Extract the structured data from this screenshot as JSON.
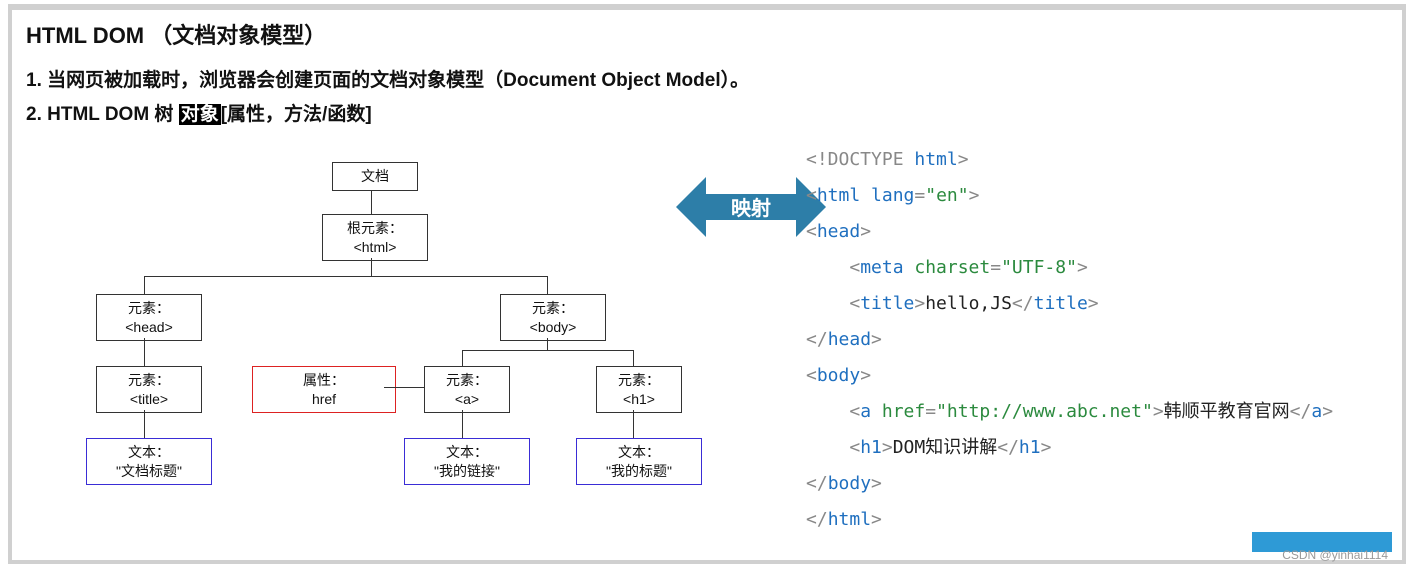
{
  "title": "HTML DOM （文档对象模型）",
  "bullets": {
    "b1_num": "1.",
    "b1_a": " 当网页被加载时，浏览器会创建页面的文档对象模型（",
    "b1_bold": "Document Object Model",
    "b1_b": "）。",
    "b2_num": "2. ",
    "b2_a": "HTML DOM",
    "b2_b": " 树 ",
    "b2_hilite": "对象",
    "b2_c": "[属性，方法/函数]"
  },
  "tree": {
    "doc": "文档",
    "root_l1": "根元素：",
    "root_l2": "<html>",
    "head_l1": "元素：",
    "head_l2": "<head>",
    "body_l1": "元素：",
    "body_l2": "<body>",
    "title_l1": "元素：",
    "title_l2": "<title>",
    "attr_l1": "属性：",
    "attr_l2": "href",
    "a_l1": "元素：",
    "a_l2": "<a>",
    "h1_l1": "元素：",
    "h1_l2": "<h1>",
    "text1_l1": "文本：",
    "text1_l2": "\"文档标题\"",
    "text2_l1": "文本：",
    "text2_l2": "\"我的链接\"",
    "text3_l1": "文本：",
    "text3_l2": "\"我的标题\""
  },
  "arrow_label": "映射",
  "code": {
    "doctype_a": "<!DOCTYPE ",
    "doctype_b": "html",
    "doctype_c": ">",
    "html_open_a": "<",
    "html_open_b": "html ",
    "html_open_attr": "lang",
    "html_open_eq": "=",
    "html_open_str": "\"en\"",
    "html_open_c": ">",
    "head_open_a": "<",
    "head_open_b": "head",
    "head_open_c": ">",
    "meta_a": "    <",
    "meta_b": "meta ",
    "meta_attr": "charset",
    "meta_eq": "=",
    "meta_str": "\"UTF-8\"",
    "meta_c": ">",
    "title_open_a": "    <",
    "title_open_b": "title",
    "title_open_c": ">",
    "title_text": "hello,JS",
    "title_close_a": "</",
    "title_close_b": "title",
    "title_close_c": ">",
    "head_close_a": "</",
    "head_close_b": "head",
    "head_close_c": ">",
    "body_open_a": "<",
    "body_open_b": "body",
    "body_open_c": ">",
    "a_a": "    <",
    "a_b": "a ",
    "a_attr": "href",
    "a_eq": "=",
    "a_str": "\"http://www.abc.net\"",
    "a_c": ">",
    "a_text": "韩顺平教育官网",
    "a_close_a": "</",
    "a_close_b": "a",
    "a_close_c": ">",
    "h1_a": "    <",
    "h1_b": "h1",
    "h1_c": ">",
    "h1_text": "DOM知识讲解",
    "h1_close_a": "</",
    "h1_close_b": "h1",
    "h1_close_c": ">",
    "body_close_a": "</",
    "body_close_b": "body",
    "body_close_c": ">",
    "html_close_a": "</",
    "html_close_b": "html",
    "html_close_c": ">"
  },
  "watermark": "CSDN @yinhai1114"
}
